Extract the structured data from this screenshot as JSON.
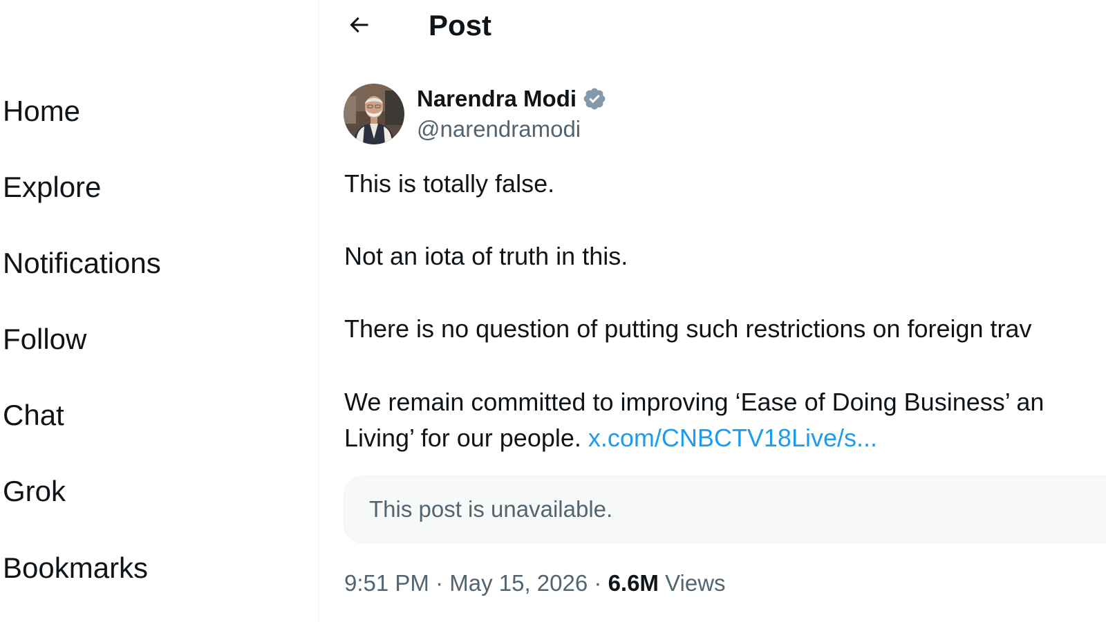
{
  "sidebar": {
    "items": [
      {
        "label": "Home"
      },
      {
        "label": "Explore"
      },
      {
        "label": "Notifications"
      },
      {
        "label": "Follow"
      },
      {
        "label": "Chat"
      },
      {
        "label": "Grok"
      },
      {
        "label": "Bookmarks"
      }
    ]
  },
  "header": {
    "title": "Post",
    "back_icon": "arrow-left-icon"
  },
  "post": {
    "author": {
      "display_name": "Narendra Modi",
      "handle": "@narendramodi",
      "verified_icon": "verified-badge-icon"
    },
    "paragraphs": [
      "This is totally false.",
      "Not an iota of truth in this.",
      "There is no question of putting such restrictions on foreign trav",
      "We remain committed to improving ‘Ease of Doing Business’ an"
    ],
    "last_line_text": "Living’ for our people. ",
    "link_text": "x.com/CNBCTV18Live/s...",
    "quote_unavailable": "This post is unavailable.",
    "time": "9:51 PM",
    "separator": "·",
    "date": "May 15, 2026",
    "views_count": "6.6M",
    "views_label": "Views"
  },
  "colors": {
    "text_primary": "#0f1419",
    "text_secondary": "#536471",
    "link": "#1d9bf0",
    "verified": "#829aab",
    "quote_bg": "#f7f9f9",
    "border": "#eff3f4"
  }
}
